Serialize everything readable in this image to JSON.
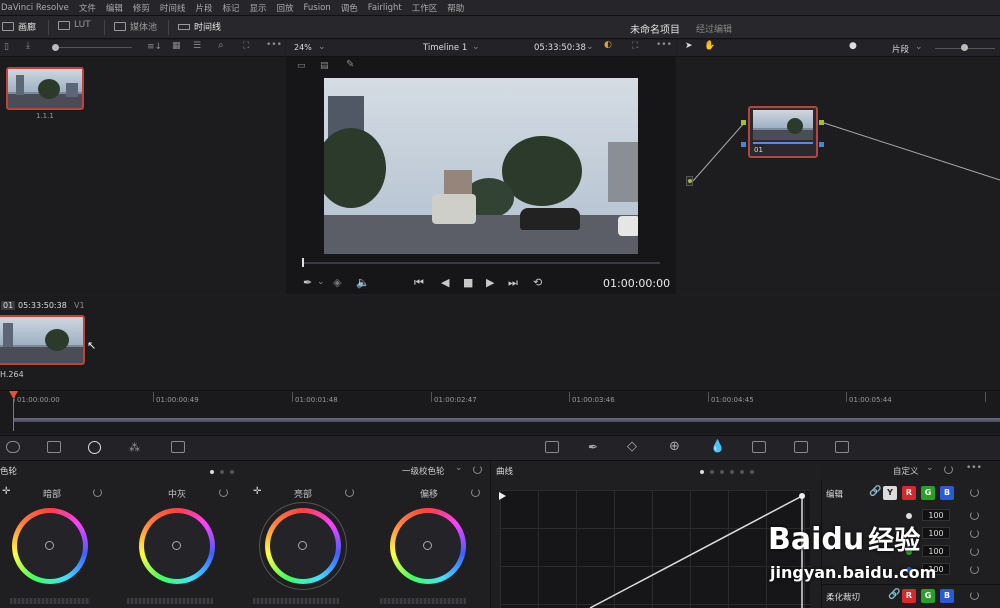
{
  "menu": [
    "DaVinci Resolve",
    "文件",
    "编辑",
    "修剪",
    "时间线",
    "片段",
    "标记",
    "显示",
    "回放",
    "Fusion",
    "调色",
    "Fairlight",
    "工作区",
    "帮助"
  ],
  "toolbar": {
    "gallery": "画廊",
    "lut": "LUT",
    "media_pool": "媒体池",
    "timeline": "时间线",
    "project_title": "未命名项目",
    "edited": "经过编辑"
  },
  "gallery": {
    "still_label": "1.1.1"
  },
  "viewer": {
    "zoom": "24%",
    "timeline_name": "Timeline 1",
    "timecode": "05:33:50:38",
    "playhead_tc": "01:00:00:00"
  },
  "node_editor": {
    "mode": "片段",
    "node_label": "01"
  },
  "clips": {
    "index": "01",
    "timecode": "05:33:50:38",
    "track": "V1",
    "codec": "H.264"
  },
  "ruler": [
    "01:00:00:00",
    "01:00:00:49",
    "01:00:01:48",
    "01:00:02:47",
    "01:00:03:46",
    "01:00:04:45",
    "01:00:05:44"
  ],
  "color_wheels": {
    "title": "色轮",
    "mode": "一级校色轮",
    "wheels": [
      "暗部",
      "中灰",
      "亮部",
      "偏移"
    ]
  },
  "curves": {
    "title": "曲线",
    "mode": "自定义"
  },
  "edit_panel": {
    "title": "编辑",
    "channels": [
      "Y",
      "R",
      "G",
      "B"
    ],
    "values": [
      "100",
      "100",
      "100",
      "100"
    ],
    "soft_clip": "柔化裁切"
  },
  "watermark": {
    "brand": "Baidu",
    "cn": "经验",
    "url": "jingyan.baidu.com"
  },
  "colors": {
    "accent": "#c0433a",
    "Y": "#dcdcdc",
    "R": "#d62a2a",
    "G": "#2aa02a",
    "B": "#2a5ad6"
  }
}
